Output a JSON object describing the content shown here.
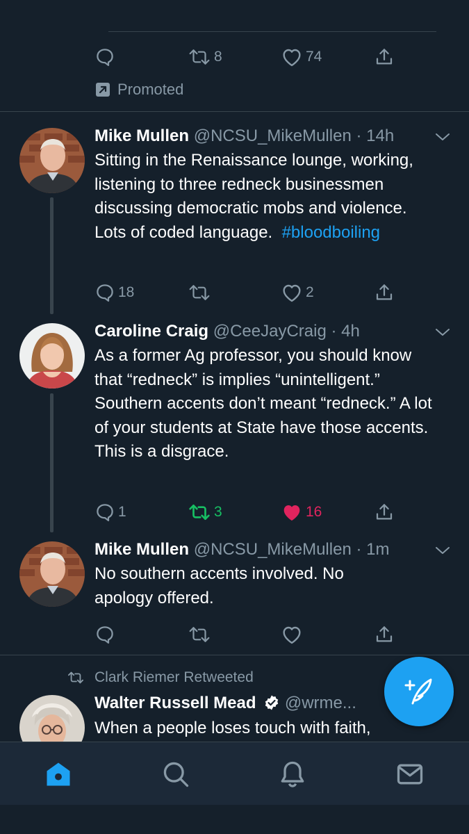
{
  "top_tweet": {
    "reply_count": "",
    "retweet_count": "8",
    "like_count": "74",
    "promoted_label": "Promoted"
  },
  "tweets": [
    {
      "name": "Mike Mullen",
      "handle": "@NCSU_MikeMullen",
      "time": "14h",
      "text": "Sitting in the Renaissance lounge, working, listening to three redneck businessmen discussing democratic mobs and violence.  Lots of coded language.",
      "hashtag": "#bloodboiling",
      "reply_count": "18",
      "retweet_count": "",
      "like_count": "2"
    },
    {
      "name": "Caroline Craig",
      "handle": "@CeeJayCraig",
      "time": "4h",
      "text": "As a former Ag professor, you should know that “redneck” is implies “unintelligent.” Southern accents don’t meant “redneck.” A lot of your students at State have those accents. This is a disgrace.",
      "reply_count": "1",
      "retweet_count": "3",
      "like_count": "16"
    },
    {
      "name": "Mike Mullen",
      "handle": "@NCSU_MikeMullen",
      "time": "1m",
      "text": "No southern accents involved. No apology offered.",
      "reply_count": "",
      "retweet_count": "",
      "like_count": ""
    }
  ],
  "retweeted": {
    "retweeter_label": "Clark Riemer Retweeted",
    "name": "Walter Russell Mead",
    "handle": "@wrme...",
    "text": "When a people loses touch with faith,"
  },
  "colors": {
    "background": "#15202b",
    "accent": "#1da1f2",
    "retweet_active": "#17bf63",
    "like_active": "#e0245e",
    "muted": "#8899a6"
  },
  "icons": {
    "reply": "speech-bubble",
    "retweet": "retweet-arrows",
    "like": "heart",
    "share": "share-arrow",
    "promoted": "promoted-arrow",
    "more": "chevron-down",
    "verified": "verified-badge",
    "compose": "feather-plus",
    "tabs": [
      "home",
      "search",
      "notifications",
      "messages"
    ]
  }
}
